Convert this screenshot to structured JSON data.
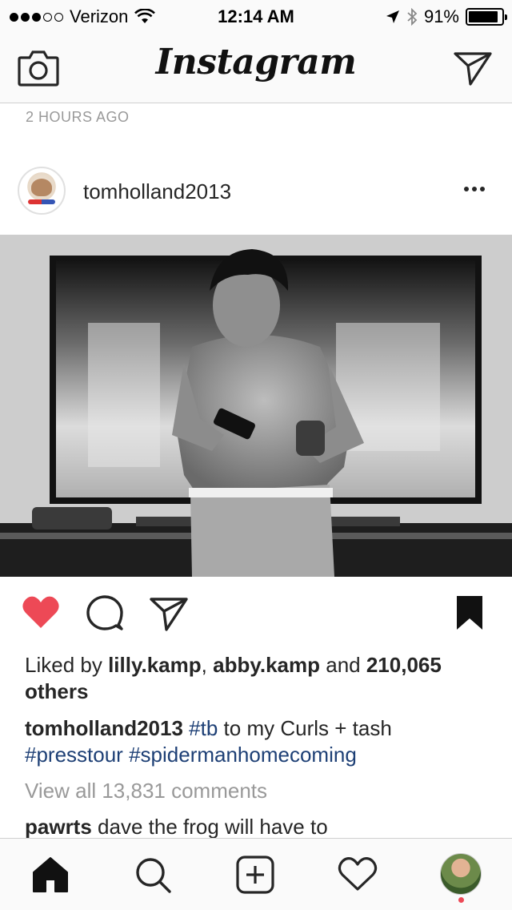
{
  "status_bar": {
    "carrier": "Verizon",
    "time": "12:14 AM",
    "battery": "91%",
    "battery_level": 0.91,
    "signal_bars_filled": 3,
    "signal_bars_total": 5
  },
  "header": {
    "logo": "Instagram",
    "camera_icon": "camera-icon",
    "direct_icon": "paper-plane-icon"
  },
  "previous_post": {
    "timestamp": "2 HOURS AGO"
  },
  "post": {
    "username": "tomholland2013",
    "more_icon": "ellipsis-icon",
    "liked": true,
    "likes": {
      "prefix": "Liked by ",
      "user1": "lilly.kamp",
      "separator": ", ",
      "user2": "abby.kamp",
      "and": " and ",
      "count": "210,065",
      "others": " others"
    },
    "caption": {
      "username": "tomholland2013",
      "tag1": "#tb",
      "text": " to my Curls + tash ",
      "tag2": "#presstour",
      "tag3": "#spidermanhomecoming"
    },
    "view_all_comments": "View all 13,831 comments",
    "first_comment": {
      "username": "pawrts",
      "text": " dave the frog will have to"
    }
  },
  "tab_bar": {
    "items": [
      "home-icon",
      "search-icon",
      "add-post-icon",
      "activity-heart-icon",
      "profile-avatar"
    ]
  },
  "colors": {
    "like_red": "#ed4956",
    "hashtag_blue": "#1d3f75",
    "muted_gray": "#999999",
    "bar_background": "#fafafa"
  }
}
